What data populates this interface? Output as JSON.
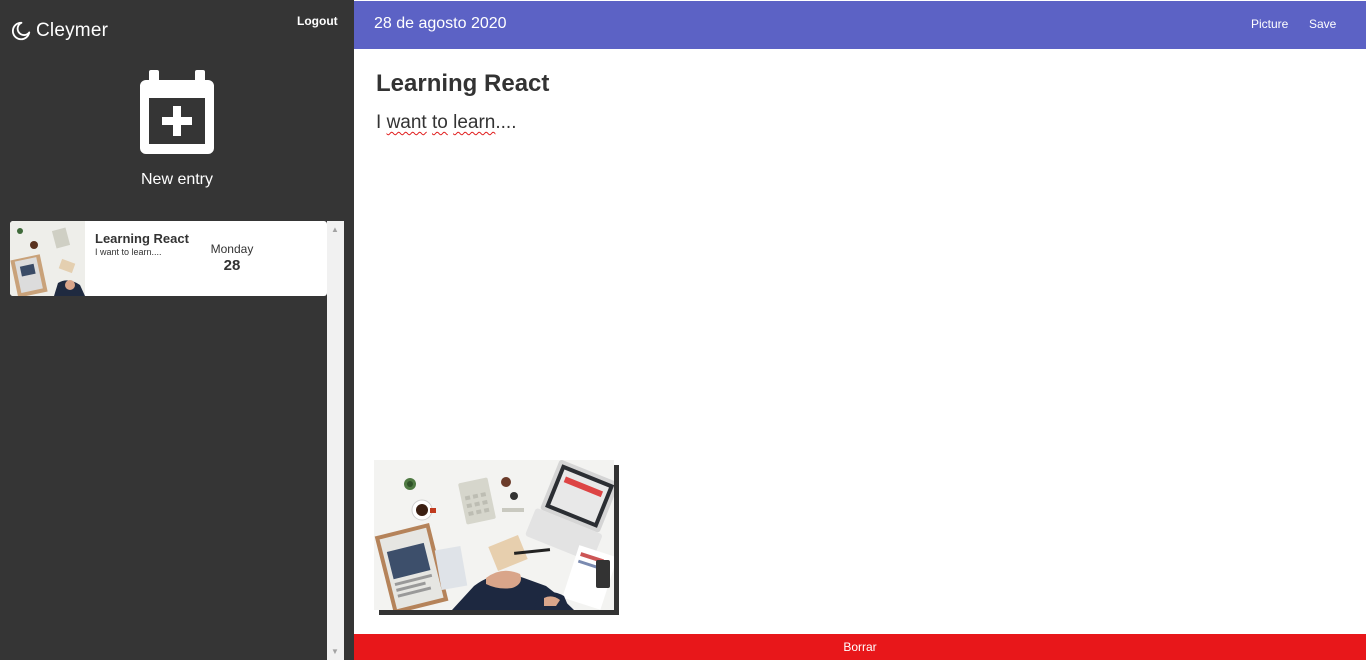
{
  "brand": {
    "name": "Cleymer",
    "icon": "moon-icon"
  },
  "sidebar": {
    "logout_label": "Logout",
    "new_entry": {
      "label": "New entry",
      "icon": "calendar-plus-icon"
    },
    "entries": [
      {
        "title": "Learning React",
        "snippet": "I want to learn....",
        "day_name": "Monday",
        "day_number": "28"
      }
    ]
  },
  "header": {
    "date": "28 de agosto 2020",
    "picture_label": "Picture",
    "save_label": "Save"
  },
  "note": {
    "title": "Learning React",
    "body": {
      "w1": "I",
      "w2": "want",
      "w3": "to",
      "w4": "learn",
      "tail": "...."
    }
  },
  "delete_label": "Borrar",
  "colors": {
    "sidebar": "#353535",
    "accent": "#5c62c5",
    "danger": "#e8171a"
  }
}
